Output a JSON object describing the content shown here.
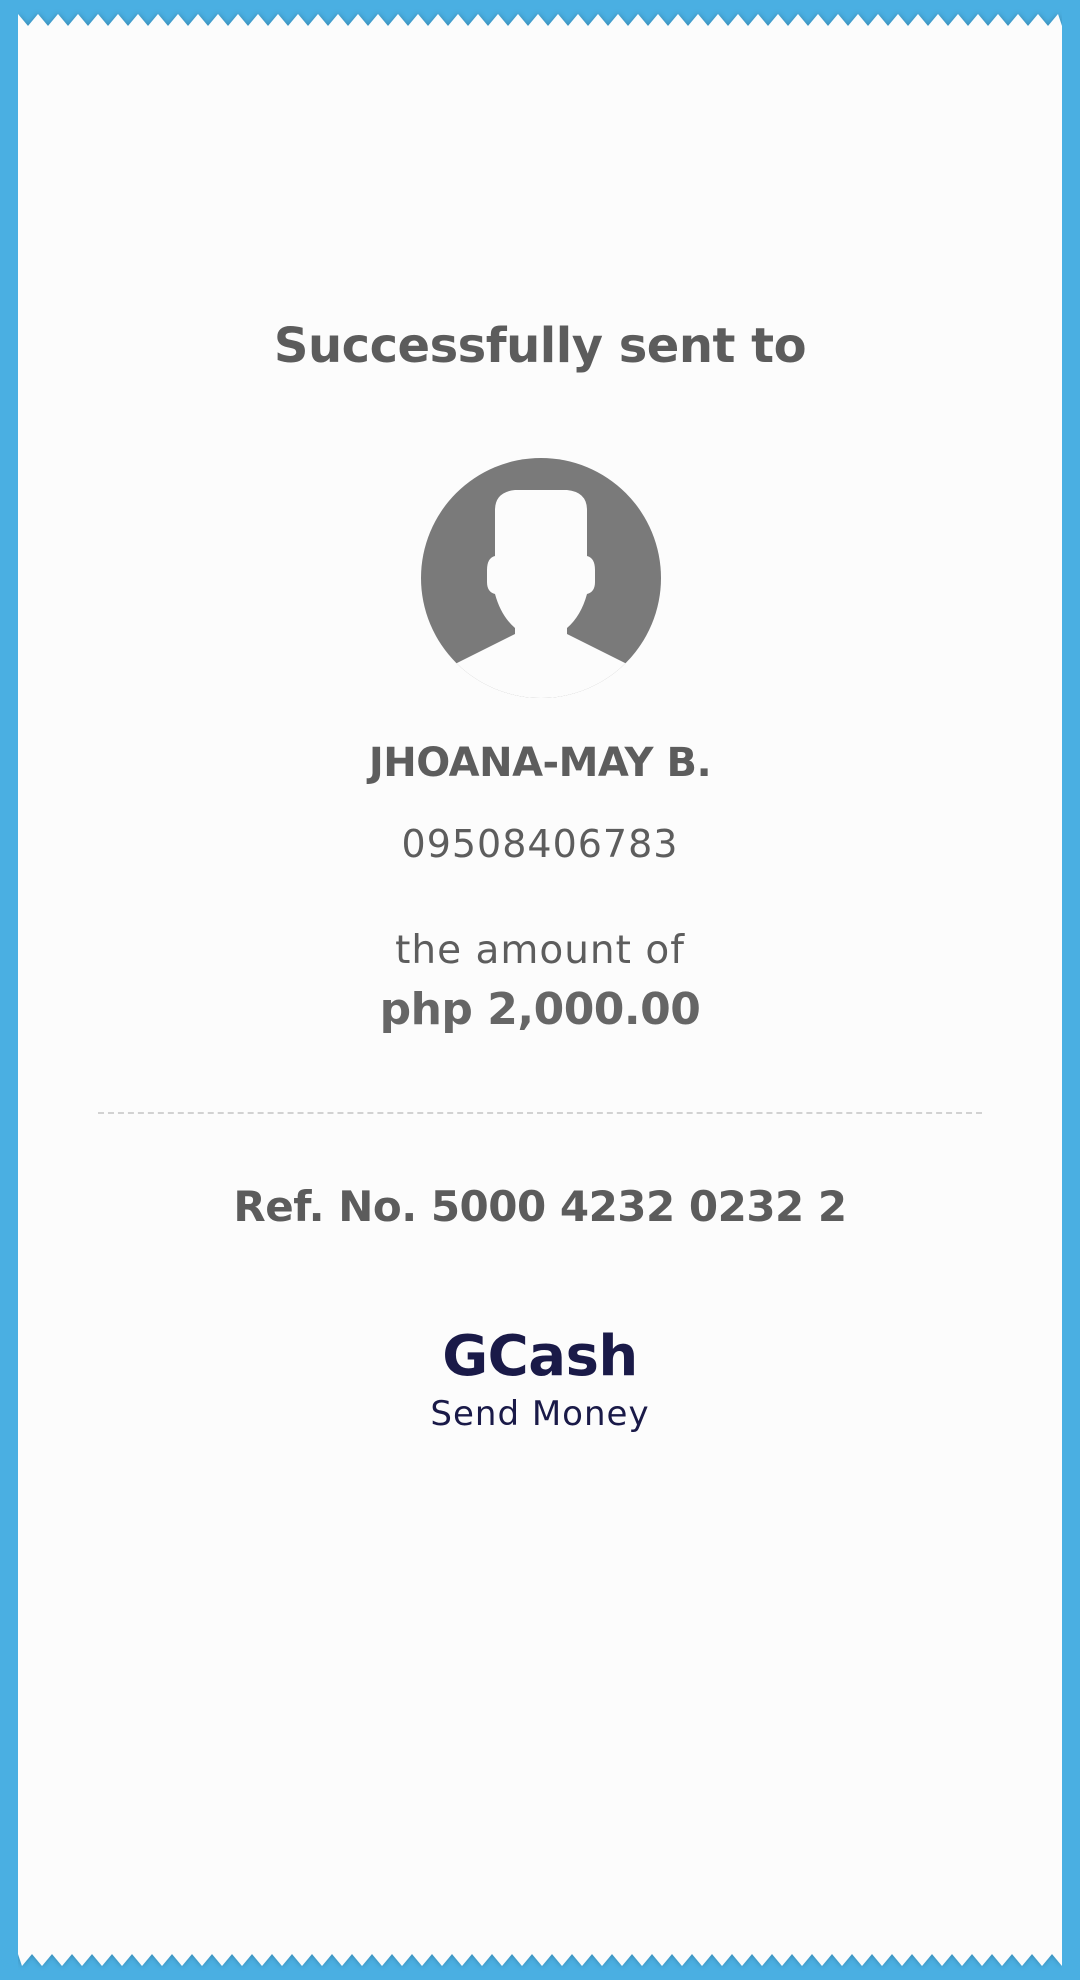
{
  "receipt": {
    "title": "Successfully sent to",
    "recipient": {
      "name": "JHOANA-MAY B.",
      "phone": "09508406783",
      "avatar_icon": "user-avatar-icon"
    },
    "amount_label": "the amount of",
    "amount_value": "php 2,000.00",
    "reference": "Ref. No. 5000 4232 0232 2",
    "brand": "GCash",
    "brand_sub": "Send Money"
  },
  "colors": {
    "background": "#4aafe2",
    "paper": "#fcfcfc",
    "text": "#5c5c5c",
    "brand": "#1a1a48",
    "avatar": "#7a7a7a"
  }
}
